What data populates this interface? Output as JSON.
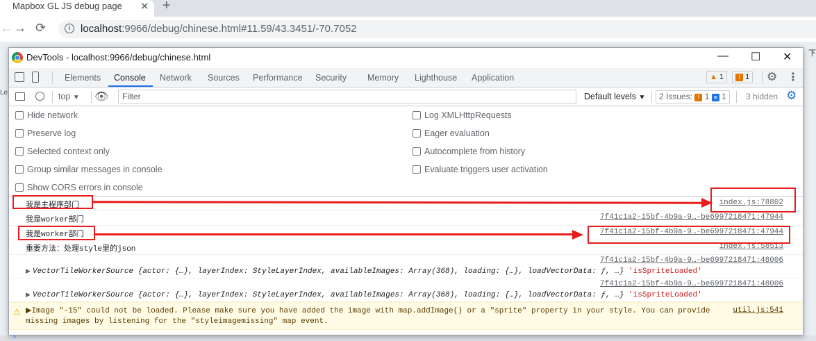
{
  "browser": {
    "tab_title": "Mapbox GL JS debug page",
    "close_glyph": "✕",
    "new_tab_glyph": "+",
    "back_glyph": "←",
    "forward_glyph": "→",
    "reload_glyph": "⟳",
    "url_host": "localhost",
    "url_rest": ":9966/debug/chinese.html#11.59/43.3451/-70.7052"
  },
  "page_behind": {
    "left_edge_text": "Le",
    "right_edge_text": "下"
  },
  "devtools": {
    "window_title": "DevTools - localhost:9966/debug/chinese.html",
    "window_controls": {
      "minimize": "—",
      "maximize": "☐",
      "close": "✕"
    },
    "tabs": [
      "Elements",
      "Console",
      "Network",
      "Sources",
      "Performance",
      "Security",
      "Memory",
      "Lighthouse",
      "Application"
    ],
    "active_tab": "Console",
    "badges": {
      "warnings": "1",
      "issues": "1"
    },
    "toolbar": {
      "context": "top",
      "filter_placeholder": "Filter",
      "default_levels": "Default levels",
      "issues_label": "2 Issues:",
      "issues_warn": "1",
      "issues_info": "1",
      "hidden": "3 hidden"
    },
    "settings_left": [
      "Hide network",
      "Preserve log",
      "Selected context only",
      "Group similar messages in console",
      "Show CORS errors in console"
    ],
    "settings_right": [
      "Log XMLHttpRequests",
      "Eager evaluation",
      "Autocomplete from history",
      "Evaluate triggers user activation"
    ],
    "logs": [
      {
        "msg": "我是主程序部门",
        "src": "index.js:78802"
      },
      {
        "msg": "我是worker部门",
        "src": "7f41c1a2-15bf-4b9a-9…-be6997218471:47944"
      },
      {
        "msg": "我是worker部门",
        "src": "7f41c1a2-15bf-4b9a-9…-be6997218471:47944"
      },
      {
        "msg": "重要方法：处理style里的json",
        "src": "index.js:58513"
      }
    ],
    "object_logs": [
      {
        "src": "7f41c1a2-15bf-4b9a-9…-be6997218471:48006",
        "name": "VectorTileWorkerSource",
        "body": " {actor: {…}, layerIndex: StyleLayerIndex, availableImages: Array(368), loading: {…}, loadVectorData: ƒ, …}",
        "str": " 'isSpriteLoaded'"
      },
      {
        "src": "7f41c1a2-15bf-4b9a-9…-be6997218471:48006",
        "name": "VectorTileWorkerSource",
        "body": " {actor: {…}, layerIndex: StyleLayerIndex, availableImages: Array(368), loading: {…}, loadVectorData: ƒ, …}",
        "str": " 'isSpriteLoaded'"
      }
    ],
    "warning": {
      "line1": "▶Image \"-15\" could not be loaded. Please make sure you have added the image with map.addImage() or a \"sprite\" property in your style. You can provide",
      "line2": "missing images by listening for the \"styleimagemissing\" map event.",
      "src": "util.js:541"
    }
  },
  "annotation_color": "#e81c1c"
}
